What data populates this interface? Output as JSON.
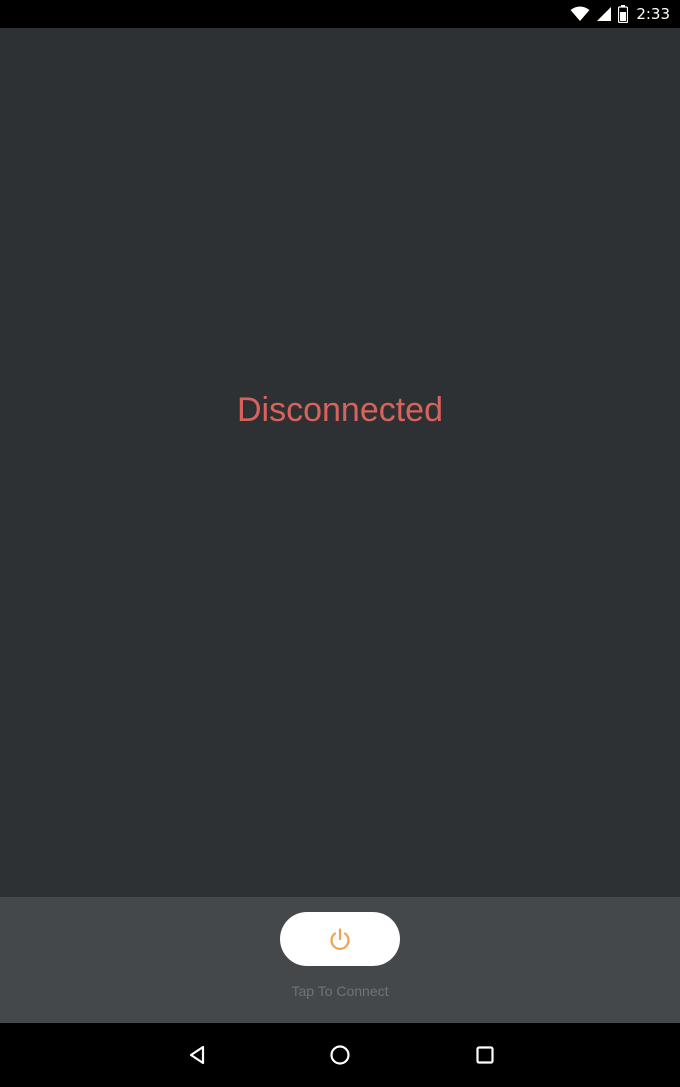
{
  "status_bar": {
    "time": "2:33",
    "icons": [
      "wifi-icon",
      "signal-icon",
      "battery-icon"
    ]
  },
  "main": {
    "connection_status": "Disconnected",
    "status_color": "#d9625c"
  },
  "bottom_panel": {
    "connect_button_icon": "power-icon",
    "connect_label": "Tap To Connect",
    "accent_color": "#f0a14e"
  },
  "nav_bar": {
    "buttons": [
      "back-icon",
      "home-icon",
      "recents-icon"
    ]
  }
}
